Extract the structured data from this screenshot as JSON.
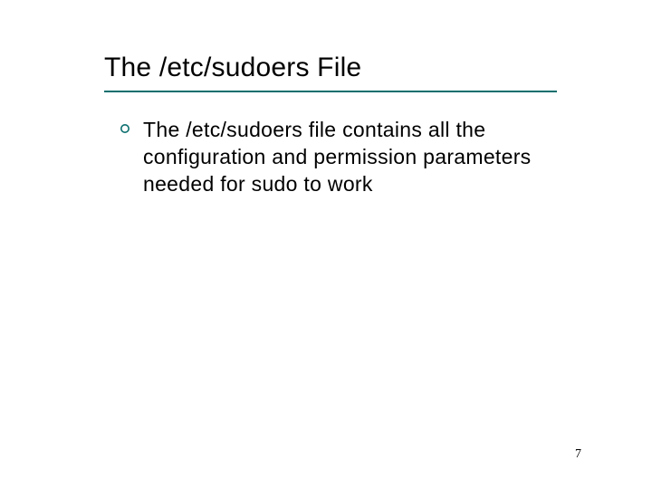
{
  "slide": {
    "title": "The /etc/sudoers File",
    "bullets": [
      {
        "text": "The /etc/sudoers file contains all the configuration and permission parameters needed for sudo to work"
      }
    ],
    "page_number": "7"
  }
}
